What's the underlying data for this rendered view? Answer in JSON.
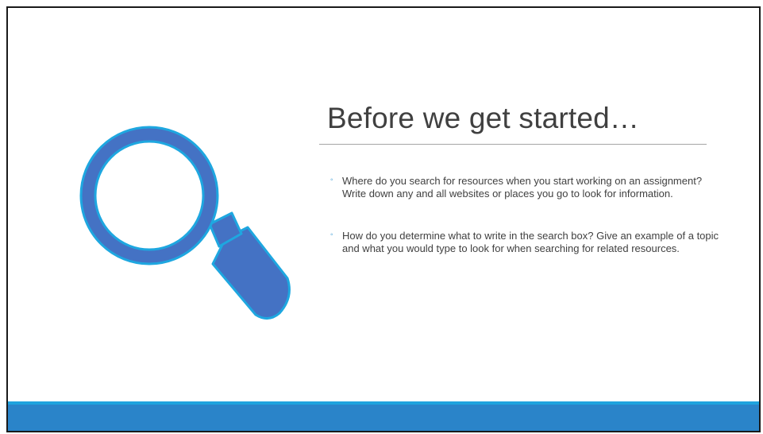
{
  "slide": {
    "title": "Before we get started…",
    "bullets": [
      {
        "marker": "◦",
        "text": "Where do you search for resources when you start working on an assignment? Write down any and all websites or places you go to look for information."
      },
      {
        "marker": "◦",
        "text": "How do you determine what to write in the search box? Give an example of a topic and what you would type to look for when searching for related resources."
      }
    ],
    "icon": "magnifying-glass-icon"
  },
  "colors": {
    "lens": "#4472c4",
    "lens_outline": "#1ea7e0",
    "accent_band": "#2a84c9",
    "accent_stripe": "#1fa3de",
    "title_text": "#404040",
    "bullet_marker": "#2f95d3"
  }
}
